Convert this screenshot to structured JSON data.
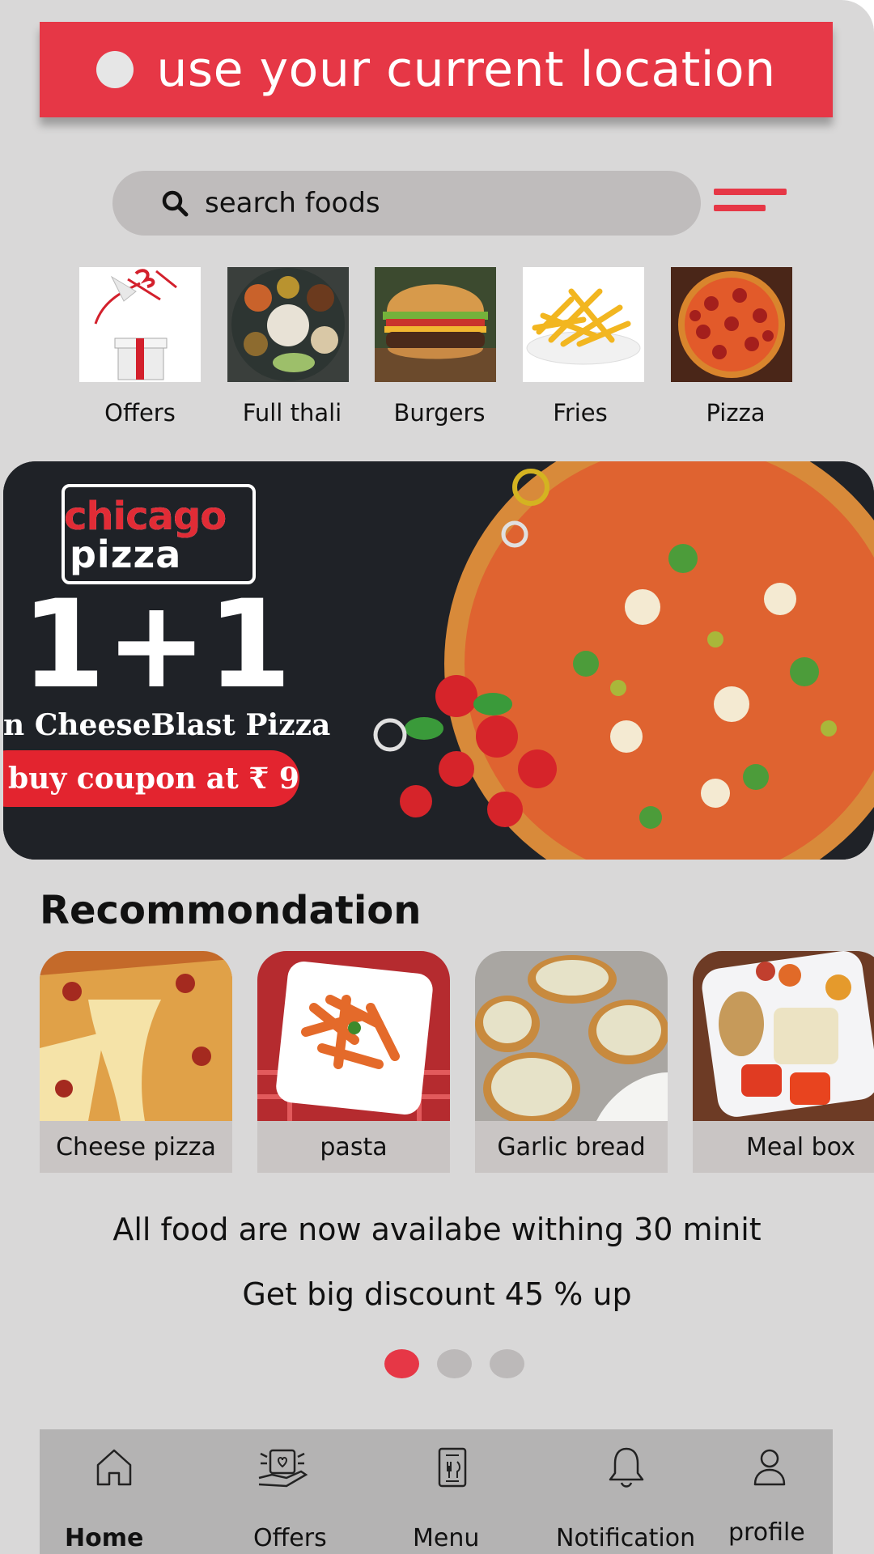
{
  "location_button": {
    "label": "use your current location",
    "color": "#e63746"
  },
  "search": {
    "placeholder": "search foods"
  },
  "categories": [
    {
      "label": "Offers",
      "image": "gift-box"
    },
    {
      "label": "Full thali",
      "image": "thali-plate"
    },
    {
      "label": "Burgers",
      "image": "burger"
    },
    {
      "label": "Fries",
      "image": "french-fries"
    },
    {
      "label": "Pizza",
      "image": "pepperoni-pizza"
    }
  ],
  "banner": {
    "brand_line1": "chicago",
    "brand_line2": "pizza",
    "offer": "1+1",
    "subtitle": "n CheeseBlast Pizza",
    "coupon": "buy coupon at ₹ 9"
  },
  "recommendation": {
    "title": "Recommondation",
    "items": [
      {
        "label": "Cheese pizza",
        "image": "cheese-pizza"
      },
      {
        "label": "pasta",
        "image": "penne-pasta"
      },
      {
        "label": "Garlic bread",
        "image": "garlic-bread"
      },
      {
        "label": "Meal  box",
        "image": "meal-box"
      }
    ]
  },
  "info": {
    "line1": "All food are now availabe withing 30 minit",
    "line2": "Get big discount 45 % up"
  },
  "pagination": {
    "pages": 3,
    "active": 1
  },
  "bottom_nav": [
    {
      "label": "Home",
      "icon": "home-icon",
      "active": true
    },
    {
      "label": "Offers",
      "icon": "offers-icon"
    },
    {
      "label": "Menu",
      "icon": "menu-icon"
    },
    {
      "label": "Notification",
      "icon": "bell-icon"
    },
    {
      "label": "profile",
      "icon": "user-icon"
    }
  ]
}
